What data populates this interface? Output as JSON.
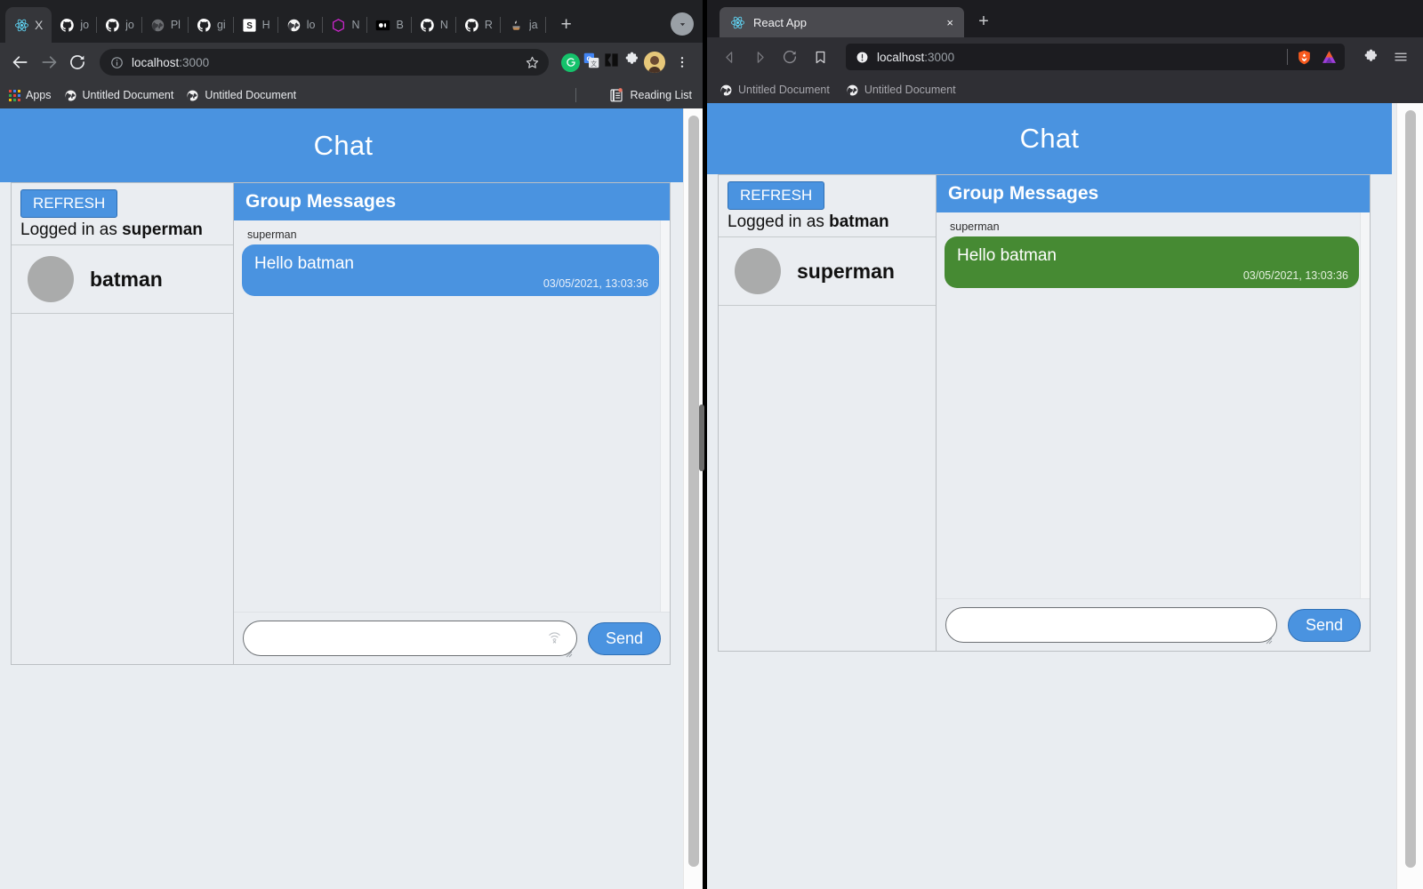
{
  "chrome": {
    "tabs": [
      {
        "label": "X",
        "icon": "react-icon",
        "active": true,
        "closable": true
      },
      {
        "label": "jo",
        "icon": "github-icon",
        "active": false
      },
      {
        "label": "jo",
        "icon": "github-icon",
        "active": false
      },
      {
        "label": "Pl",
        "icon": "globe-icon",
        "active": false
      },
      {
        "label": "gi",
        "icon": "github-icon",
        "active": false
      },
      {
        "label": "H",
        "icon": "stackoverflow-s-icon",
        "active": false
      },
      {
        "label": "lo",
        "icon": "globe-icon",
        "active": false
      },
      {
        "label": "N",
        "icon": "hexagon-icon",
        "active": false
      },
      {
        "label": "B",
        "icon": "medium-icon",
        "active": false
      },
      {
        "label": "N",
        "icon": "github-icon",
        "active": false
      },
      {
        "label": "R",
        "icon": "github-icon",
        "active": false
      },
      {
        "label": "ja",
        "icon": "java-icon",
        "active": false
      }
    ],
    "new_tab_label": "+",
    "toolbar": {
      "back_icon": "back-arrow-icon",
      "forward_icon": "forward-arrow-icon",
      "reload_icon": "reload-icon",
      "site_info_icon": "info-circle-icon",
      "url_host": "localhost",
      "url_port": ":3000",
      "bookmark_icon": "star-icon",
      "extensions": [
        "grammarly-icon",
        "google-translate-icon",
        "mailtrack-icon",
        "puzzle-extensions-icon"
      ],
      "avatar_icon": "profile-avatar",
      "menu_icon": "three-dot-menu-icon"
    },
    "bookmarks": {
      "apps_label": "Apps",
      "items": [
        "Untitled Document",
        "Untitled Document"
      ],
      "reading_list_label": "Reading List"
    }
  },
  "brave": {
    "tab": {
      "title": "React App",
      "icon": "react-icon",
      "close_label": "×"
    },
    "new_tab_label": "+",
    "toolbar": {
      "back_icon": "back-arrow-icon",
      "forward_icon": "forward-arrow-icon",
      "reload_icon": "reload-icon",
      "bookmark_icon": "bookmark-icon",
      "site_info_icon": "not-secure-icon",
      "url_host": "localhost",
      "url_port": ":3000",
      "badges": [
        "brave-shields-icon",
        "brave-rewards-icon"
      ],
      "extensions_icon": "puzzle-extensions-icon",
      "menu_icon": "hamburger-menu-icon"
    },
    "bookmarks": {
      "items": [
        "Untitled Document",
        "Untitled Document"
      ]
    }
  },
  "app_left": {
    "header_title": "Chat",
    "refresh_label": "REFRESH",
    "logged_in_prefix": "Logged in as ",
    "logged_in_user": "superman",
    "users": [
      {
        "name": "batman",
        "avatar": "user-avatar"
      }
    ],
    "messages_title": "Group Messages",
    "messages": [
      {
        "sender": "superman",
        "body": "Hello batman",
        "timestamp": "03/05/2021, 13:03:36",
        "bubble_color": "#4a93e0"
      }
    ],
    "compose": {
      "input_value": "",
      "input_placeholder": "",
      "dictate_icon": "dictation-off-icon",
      "send_label": "Send"
    }
  },
  "app_right": {
    "header_title": "Chat",
    "refresh_label": "REFRESH",
    "logged_in_prefix": "Logged in as ",
    "logged_in_user": "batman",
    "users": [
      {
        "name": "superman",
        "avatar": "user-avatar"
      }
    ],
    "messages_title": "Group Messages",
    "messages": [
      {
        "sender": "superman",
        "body": "Hello batman",
        "timestamp": "03/05/2021, 13:03:36",
        "bubble_color": "#468a33"
      }
    ],
    "compose": {
      "input_value": "",
      "input_placeholder": "",
      "send_label": "Send"
    }
  },
  "colors": {
    "accent_blue": "#4a93e0",
    "own_message_green": "#468a33",
    "app_background": "#eaedf1",
    "chrome_chrome": "#35363a",
    "brave_chrome": "#2f2f34"
  }
}
